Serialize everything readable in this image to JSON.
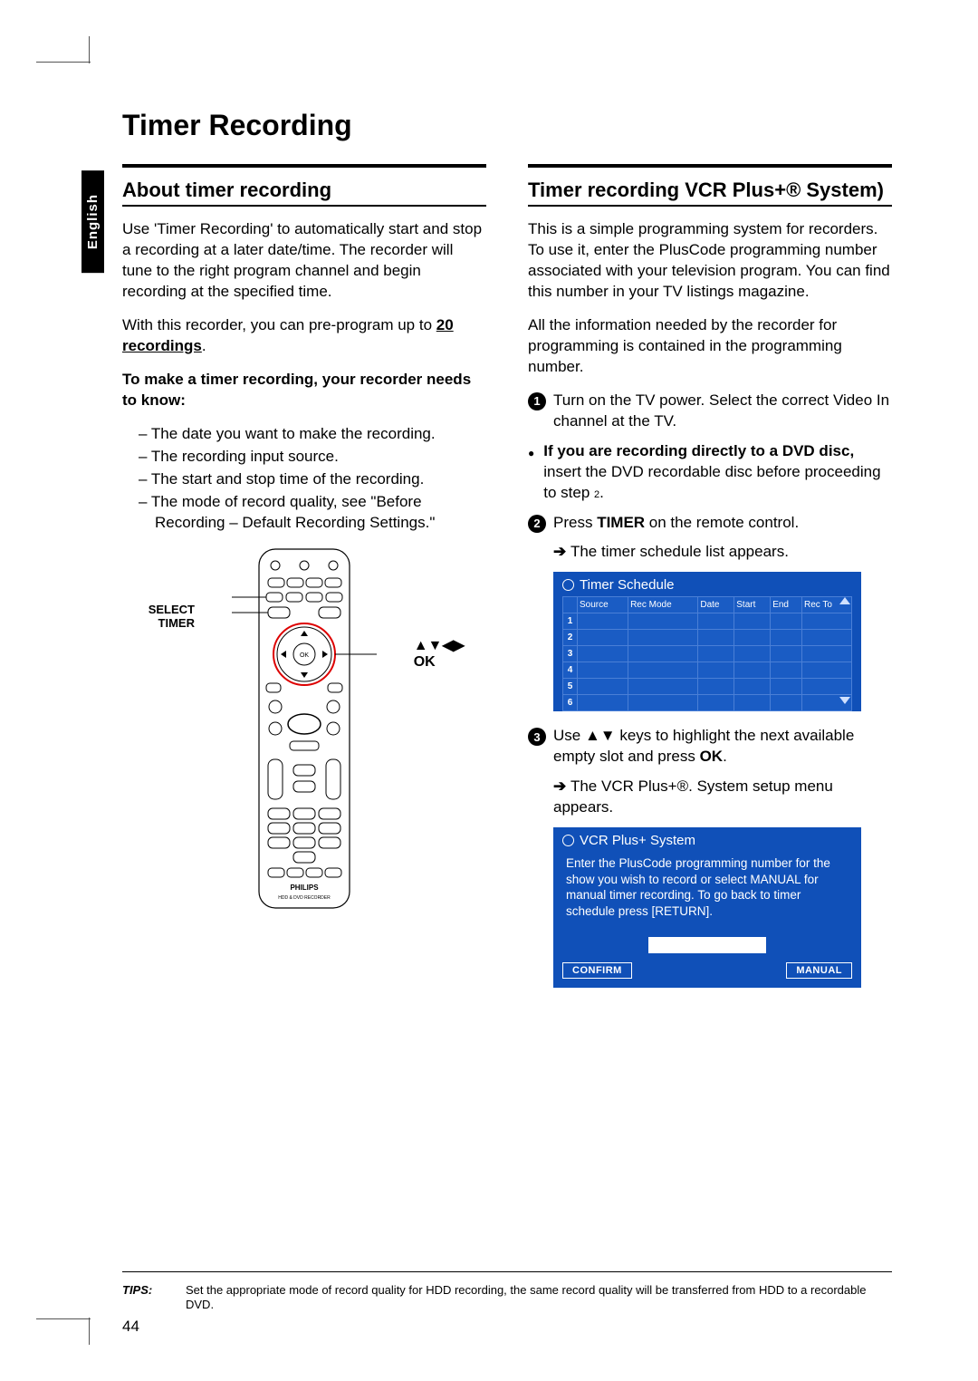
{
  "page_number": "44",
  "language_tab": "English",
  "title": "Timer Recording",
  "left": {
    "heading": "About timer recording",
    "p1": "Use 'Timer Recording' to automatically start and stop a recording at a later date/time. The recorder will tune to the right program channel and begin recording at the specified time.",
    "p2a": "With this recorder, you can pre-program up to ",
    "p2b": "20 recordings",
    "p2c": ".",
    "needs_heading": "To make a timer recording, your recorder needs to know:",
    "needs": [
      "The date you want to make the recording.",
      "The recording input source.",
      "The start and stop time of the recording.",
      "The mode of record quality, see \"Before Recording – Default Recording Settings.\""
    ],
    "remote_label_left_1": "SELECT",
    "remote_label_left_2": "TIMER",
    "remote_label_right_arrows": "▲▼◀▶",
    "remote_label_right_ok": "OK",
    "remote_brand": "PHILIPS",
    "remote_sub": "HDD & DVD RECORDER"
  },
  "right": {
    "heading": "Timer recording VCR Plus+® System)",
    "p1": "This is a simple programming system for recorders. To use it, enter the PlusCode programming number associated with your television program. You can find this number in your TV listings magazine.",
    "p2": "All the information needed by the recorder for programming is contained in the programming number.",
    "step1": "Turn on the TV power. Select the correct Video In channel at the TV.",
    "bullet_bold": "If you are recording directly to a DVD disc,",
    "bullet_rest": " insert the DVD recordable disc before proceeding to step ",
    "bullet_ref": "2",
    "bullet_end": ".",
    "step2a": "Press ",
    "step2b": "TIMER",
    "step2c": " on the remote control.",
    "arrow2": "The timer schedule list appears.",
    "screen1_title": "Timer Schedule",
    "sched_cols": [
      "Source",
      "Rec Mode",
      "Date",
      "Start",
      "End",
      "Rec To"
    ],
    "sched_rows": [
      "1",
      "2",
      "3",
      "4",
      "5",
      "6"
    ],
    "step3a": "Use ",
    "step3b": "▲▼",
    "step3c": " keys to highlight the next available empty slot and press ",
    "step3d": "OK",
    "step3e": ".",
    "arrow3a": "The VCR Plus+®. System setup menu appears.",
    "screen2_title": "VCR Plus+ System",
    "screen2_body": "Enter the PlusCode programming number for the show you wish to record or select MANUAL for manual timer recording. To go back to timer schedule press [RETURN].",
    "btn_confirm": "CONFIRM",
    "btn_manual": "MANUAL"
  },
  "tips_label": "TIPS:",
  "tips_text": "Set the appropriate mode of record quality for HDD recording, the same record quality will be transferred from HDD to a recordable DVD."
}
